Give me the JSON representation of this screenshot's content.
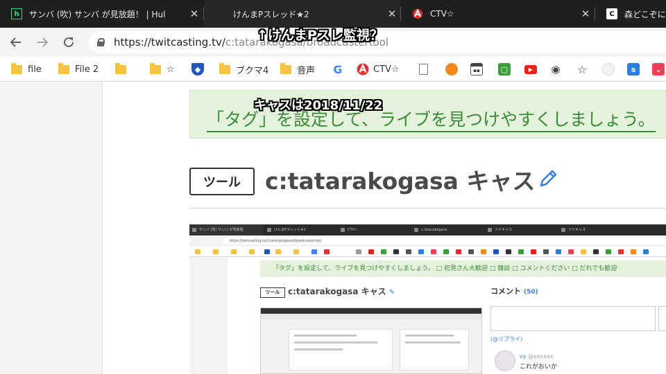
{
  "tabs": [
    {
      "title": "サンバ (吹) サンバ が見放題！ | Hul",
      "icon": "hulu-icon",
      "icon_text": "h",
      "icon_color": "#1ce783"
    },
    {
      "title": "けんまPスレッド★2",
      "icon": "blank-icon",
      "icon_text": "",
      "icon_color": "#2a2a2a"
    },
    {
      "title": "CTV☆",
      "icon": "ctv-icon",
      "icon_text": "",
      "icon_color": "#e03030"
    },
    {
      "title": "森どこぞにて",
      "icon": "c-icon",
      "icon_text": "C",
      "icon_color": "#ffffff"
    }
  ],
  "address": {
    "url_main": "https://twitcasting.tv/",
    "url_rest": "c:tatarakogasa/broadcastertool"
  },
  "bookmarks": [
    {
      "label": "file",
      "icon": "folder-icon"
    },
    {
      "label": "File 2",
      "icon": "folder-icon"
    },
    {
      "label": "",
      "icon": "folder-icon"
    },
    {
      "label": "☆",
      "icon": "folder-icon"
    },
    {
      "label": "",
      "icon": "shield-icon"
    },
    {
      "label": "ブクマ4",
      "icon": "folder-icon"
    },
    {
      "label": "音声",
      "icon": "folder-icon"
    },
    {
      "label": "",
      "icon": "google-icon"
    },
    {
      "label": "CTV☆",
      "icon": "ctv-icon"
    },
    {
      "label": "",
      "icon": "page-icon"
    },
    {
      "label": "",
      "icon": "bubble-icon"
    },
    {
      "label": "",
      "icon": "calendar-icon"
    },
    {
      "label": "",
      "icon": "green-app-icon"
    },
    {
      "label": "",
      "icon": "youtube-icon"
    },
    {
      "label": "",
      "icon": "eye-icon"
    },
    {
      "label": "",
      "icon": "star-app-icon"
    },
    {
      "label": "",
      "icon": "circle-icon"
    },
    {
      "label": "",
      "icon": "blue-app-icon"
    },
    {
      "label": "",
      "icon": "pocket-icon"
    }
  ],
  "page": {
    "notice_text": "「タグ」を設定して、ライブを見つけやすくしましょう。",
    "tool_button": "ツール",
    "cast_title": "c:tatarakogasa キャス"
  },
  "nested": {
    "url": "https://twitcasting.tv/c:tatarakogasa/broadcastertool",
    "notice_text": "「タグ」を設定して、ライブを見つけやすくしましょう。 □ 初見さん大歓迎 □ 雑談 □ コメントください □ だれでも歓迎",
    "tool_button": "ツール",
    "cast_title": "c:tatarakogasa キャス",
    "comment_label": "コメント",
    "comment_count": "(50)",
    "reply_label": "(@リプライ)",
    "user_name": "vy",
    "user_handle": "@xxxxxx",
    "message": "これがおいか"
  },
  "captions": {
    "top": "↑けんまPスレ監視？",
    "middle": "キャスは2018/11/22"
  },
  "colors": {
    "notice_bg": "#e5f3dd",
    "notice_text": "#3d8a3a",
    "pencil": "#3b7dd8",
    "tabstrip": "#1f1f1f"
  }
}
